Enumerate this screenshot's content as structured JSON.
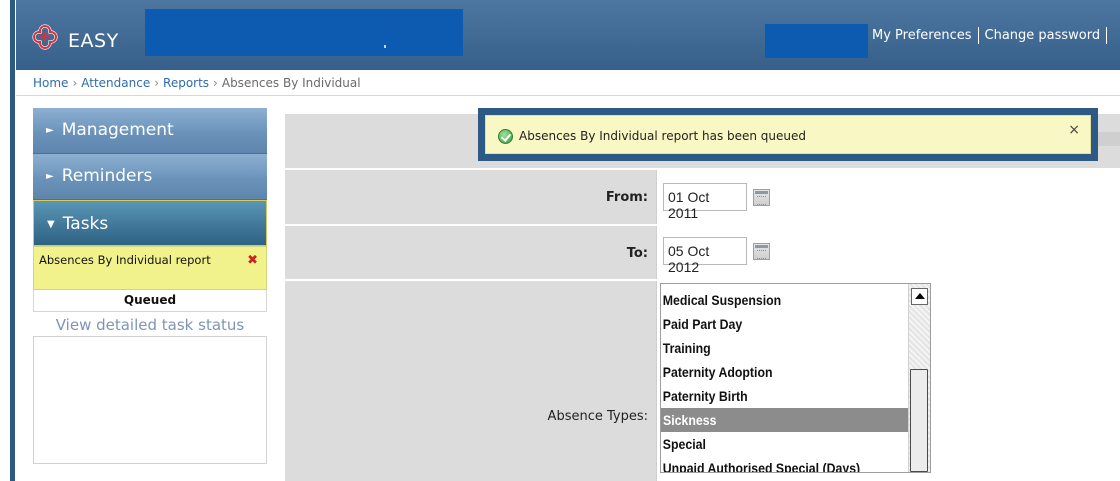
{
  "app": {
    "logo_text": "EASY",
    "colors": {
      "header": "#3e6892",
      "accent_blue": "#2f6cab",
      "notification_bg": "#f9f7c3",
      "task_bg": "#f2f28c",
      "selected_item": "#8c8c8c"
    }
  },
  "header": {
    "links": [
      "My Preferences",
      "Change password"
    ]
  },
  "breadcrumb": {
    "items": [
      "Home",
      "Attendance",
      "Reports"
    ],
    "current": "Absences By Individual",
    "separator": "›"
  },
  "sidebar": {
    "sections": [
      {
        "label": "Management",
        "expanded": false
      },
      {
        "label": "Reminders",
        "expanded": false
      },
      {
        "label": "Tasks",
        "expanded": true
      }
    ],
    "task": {
      "name": "Absences By Individual report",
      "status": "Queued"
    },
    "task_link": "View detailed task status"
  },
  "notification": {
    "message": "Absences By Individual report has been queued",
    "close_label": "×"
  },
  "form": {
    "from_label": "From:",
    "from_value": "01 Oct 2011",
    "to_label": "To:",
    "to_value": "05 Oct 2012",
    "absence_types_label": "Absence Types:",
    "absence_types": [
      "Medical Suspension",
      "Paid Part Day",
      "Training",
      "Paternity Adoption",
      "Paternity Birth",
      "Sickness",
      "Special",
      "Unpaid Authorised Special (Days)"
    ],
    "selected_absence_type": "Sickness"
  },
  "icons": {
    "logo": "ribbon-knot-logo-icon",
    "success": "check-circle-icon",
    "calendar": "calendar-icon",
    "collapsed": "triangle-right-icon",
    "expanded": "triangle-down-icon",
    "remove": "red-x-icon",
    "scroll_up": "scroll-up-arrow-icon"
  }
}
